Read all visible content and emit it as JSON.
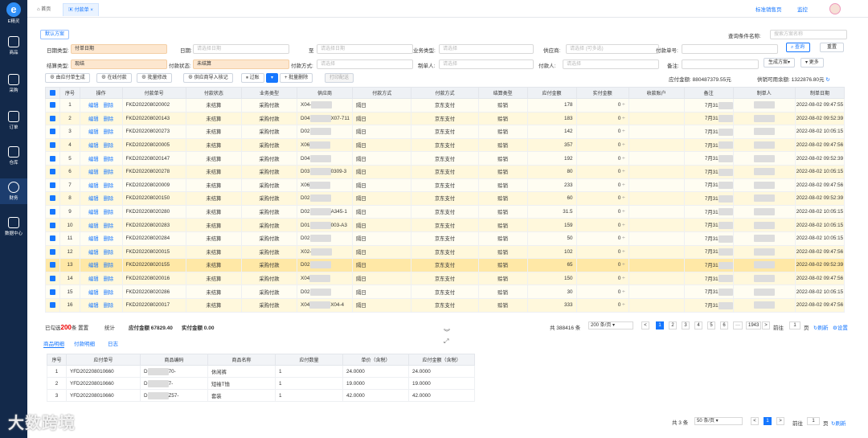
{
  "sidebar": {
    "brand": "E精灵",
    "items": [
      {
        "label": "商品"
      },
      {
        "label": "采购"
      },
      {
        "label": "订单"
      },
      {
        "label": "仓库"
      },
      {
        "label": "财务"
      },
      {
        "label": "数据中心"
      }
    ]
  },
  "tabs": [
    {
      "label": "首页"
    },
    {
      "label": "付款单"
    }
  ],
  "topright": {
    "link1": "标准销售页",
    "link2": "监控"
  },
  "scheme_tab": "默认方案",
  "query_label": "查询条件名称:",
  "query_placeholder": "搜索方案名称",
  "filters": {
    "date_type_label": "日期类型:",
    "date_type_value": "付单日期",
    "date_label": "日期:",
    "date_ph": "请选择日期",
    "to_label": "至",
    "to_ph": "请选择日期",
    "biz_label": "业务类型:",
    "biz_ph": "请选择",
    "supplier_label": "供应商:",
    "supplier_ph": "请选择 (可多选)",
    "pay_no_label": "付款单号:",
    "settle_label": "结算类型:",
    "settle_value": "现结",
    "pay_status_label": "付款状态:",
    "pay_status_value": "未结算",
    "pay_method_label": "付款方式:",
    "pay_method_ph": "请选择",
    "maker_label": "制单人:",
    "maker_ph": "请选择",
    "payer_label": "付款人:",
    "payer_ph": "请选择",
    "remark_label": "备注:"
  },
  "buttons": {
    "query": "查询",
    "reset": "重置",
    "gen_scheme": "生成方案",
    "more": "更多",
    "from_payable": "由应付单生成",
    "online": "在线付款",
    "batch_edit": "批量修改",
    "import": "供应商导入核记",
    "audit": "过账",
    "batch_delete": "批量删除",
    "print": "打印配送"
  },
  "summary": {
    "payable_label": "应付金额:",
    "payable_value": "880487379.55元",
    "balance_label": "供销可用余额:",
    "balance_value": "1322876.80元"
  },
  "columns": [
    "序号",
    "操作",
    "付款单号",
    "付款状态",
    "业务类型",
    "供应商",
    "付款方式",
    "付款方式",
    "结算类型",
    "应付金额",
    "实付金额",
    "收款账户",
    "备注",
    "制单人",
    "制单日期"
  ],
  "row_ops": {
    "edit": "编辑",
    "del": "删除"
  },
  "rows": [
    {
      "i": "1",
      "no": "FKD202208020002",
      "st": "未结算",
      "biz": "采购付款",
      "sup": "X04-",
      "d": "隔日",
      "m": "京东支付",
      "t": "赊销",
      "amt": "178",
      "paid": "0",
      "memo": "7月31",
      "date": "2022-08-02 09:47:55"
    },
    {
      "i": "2",
      "no": "FKD202208020143",
      "st": "未结算",
      "biz": "采购付款",
      "sup": "D04",
      "sup2": "X07-711",
      "d": "隔日",
      "m": "京东支付",
      "t": "赊销",
      "amt": "183",
      "paid": "0",
      "memo": "7月31",
      "date": "2022-08-02 09:52:39"
    },
    {
      "i": "3",
      "no": "FKD202208020273",
      "st": "未结算",
      "biz": "采购付款",
      "sup": "D02",
      "d": "隔日",
      "m": "京东支付",
      "t": "赊销",
      "amt": "142",
      "paid": "0",
      "memo": "7月31",
      "date": "2022-08-02 10:05:15"
    },
    {
      "i": "4",
      "no": "FKD202208020005",
      "st": "未结算",
      "biz": "采购付款",
      "sup": "X06",
      "d": "隔日",
      "m": "京东支付",
      "t": "赊销",
      "amt": "357",
      "paid": "0",
      "memo": "7月31",
      "date": "2022-08-02 09:47:56"
    },
    {
      "i": "5",
      "no": "FKD202208020147",
      "st": "未结算",
      "biz": "采购付款",
      "sup": "D04",
      "d": "隔日",
      "m": "京东支付",
      "t": "赊销",
      "amt": "192",
      "paid": "0",
      "memo": "7月31",
      "date": "2022-08-02 09:52:39"
    },
    {
      "i": "6",
      "no": "FKD202208020278",
      "st": "未结算",
      "biz": "采购付款",
      "sup": "D03",
      "sup2": "0309-3",
      "d": "隔日",
      "m": "京东支付",
      "t": "赊销",
      "amt": "80",
      "paid": "0",
      "memo": "7月31",
      "date": "2022-08-02 10:05:15"
    },
    {
      "i": "7",
      "no": "FKD202208020009",
      "st": "未结算",
      "biz": "采购付款",
      "sup": "X06",
      "d": "隔日",
      "m": "京东支付",
      "t": "赊销",
      "amt": "233",
      "paid": "0",
      "memo": "7月31",
      "date": "2022-08-02 09:47:56"
    },
    {
      "i": "8",
      "no": "FKD202208020150",
      "st": "未结算",
      "biz": "采购付款",
      "sup": "D02",
      "d": "隔日",
      "m": "京东支付",
      "t": "赊销",
      "amt": "60",
      "paid": "0",
      "memo": "7月31",
      "date": "2022-08-02 09:52:39"
    },
    {
      "i": "9",
      "no": "FKD202208020280",
      "st": "未结算",
      "biz": "采购付款",
      "sup": "D02",
      "sup2": "A345-1",
      "d": "隔日",
      "m": "京东支付",
      "t": "赊销",
      "amt": "31.5",
      "paid": "0",
      "memo": "7月31",
      "date": "2022-08-02 10:05:15"
    },
    {
      "i": "10",
      "no": "FKD202208020283",
      "st": "未结算",
      "biz": "采购付款",
      "sup": "D01",
      "sup2": "003-A3",
      "d": "隔日",
      "m": "京东支付",
      "t": "赊销",
      "amt": "159",
      "paid": "0",
      "memo": "7月31",
      "date": "2022-08-02 10:05:15"
    },
    {
      "i": "11",
      "no": "FKD202208020284",
      "st": "未结算",
      "biz": "采购付款",
      "sup": "D02",
      "d": "隔日",
      "m": "京东支付",
      "t": "赊销",
      "amt": "50",
      "paid": "0",
      "memo": "7月31",
      "date": "2022-08-02 10:05:15"
    },
    {
      "i": "12",
      "no": "FKD202208020015",
      "st": "未结算",
      "biz": "采购付款",
      "sup": "X02-",
      "d": "隔日",
      "m": "京东支付",
      "t": "赊销",
      "amt": "102",
      "paid": "0",
      "memo": "7月31",
      "date": "2022-08-02 09:47:56"
    },
    {
      "i": "13",
      "no": "FKD202208020155",
      "st": "未结算",
      "biz": "采购付款",
      "sup": "D02",
      "d": "隔日",
      "m": "京东支付",
      "t": "赊销",
      "amt": "65",
      "paid": "0",
      "memo": "7月31",
      "date": "2022-08-02 09:52:39"
    },
    {
      "i": "14",
      "no": "FKD202208020016",
      "st": "未结算",
      "biz": "采购付款",
      "sup": "X04",
      "d": "隔日",
      "m": "京东支付",
      "t": "赊销",
      "amt": "150",
      "paid": "0",
      "memo": "7月31",
      "date": "2022-08-02 09:47:56"
    },
    {
      "i": "15",
      "no": "FKD202208020286",
      "st": "未结算",
      "biz": "采购付款",
      "sup": "D02",
      "d": "隔日",
      "m": "京东支付",
      "t": "赊销",
      "amt": "30",
      "paid": "0",
      "memo": "7月31",
      "date": "2022-08-02 10:05:15"
    },
    {
      "i": "16",
      "no": "FKD202208020017",
      "st": "未结算",
      "biz": "采购付款",
      "sup": "X04",
      "sup2": "X04-4",
      "d": "隔日",
      "m": "京东支付",
      "t": "赊销",
      "amt": "333",
      "paid": "0",
      "memo": "7月31",
      "date": "2022-08-02 09:47:56"
    }
  ],
  "footer": {
    "selected_pre": "已勾选",
    "selected_count": "200",
    "selected_post": "条",
    "clear": "置置",
    "stat": "统计",
    "payable": "应付金额 67829.40",
    "paid": "实付金额 0.00",
    "total": "共 388416 条",
    "page_size": "200 条/页",
    "pages": [
      "1",
      "2",
      "3",
      "4",
      "5",
      "6",
      "1943"
    ],
    "goto": "前往",
    "goto_val": "1",
    "page_unit": "页",
    "refresh": "刷新",
    "settings": "设置"
  },
  "detail": {
    "tabs": [
      "商品明细",
      "付款明细",
      "日志"
    ],
    "columns": [
      "序号",
      "应付单号",
      "商品编码",
      "商品名称",
      "应付数量",
      "单价（含税）",
      "应付金额（含税）"
    ],
    "rows": [
      {
        "i": "1",
        "no": "YFD202208010660",
        "code": "D",
        "code2": "70-",
        "name": "休闲裤",
        "qty": "1",
        "price": "24.0000",
        "amt": "24.0000"
      },
      {
        "i": "2",
        "no": "YFD202208010660",
        "code": "D",
        "code2": "7-",
        "name": "短袖T恤",
        "qty": "1",
        "price": "19.0000",
        "amt": "19.0000"
      },
      {
        "i": "3",
        "no": "YFD202208010660",
        "code": "D",
        "code2": "Z57-",
        "name": "套装",
        "qty": "1",
        "price": "42.0000",
        "amt": "42.0000"
      }
    ],
    "total": "共 3 条",
    "page_size": "50 条/页",
    "page": "1",
    "goto": "前往",
    "goto_val": "1",
    "page_unit": "页",
    "refresh": "刷新"
  },
  "watermark": "大数跨境"
}
